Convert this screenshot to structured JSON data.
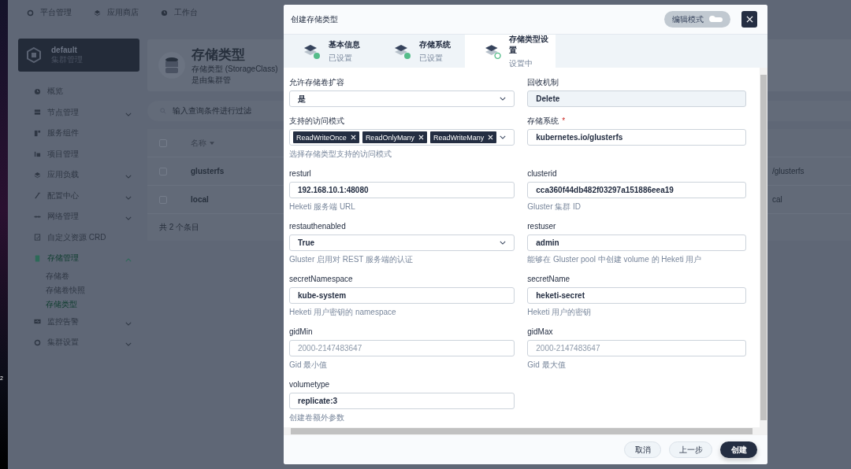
{
  "desktop": {
    "label": "2"
  },
  "top_nav": [
    {
      "label": "平台管理"
    },
    {
      "label": "应用商店"
    },
    {
      "label": "工作台"
    }
  ],
  "cluster_card": {
    "name": "default",
    "subtitle": "集群管理"
  },
  "sidebar": {
    "items": [
      {
        "label": "概览",
        "kind": "link",
        "selected": false
      },
      {
        "label": "节点管理",
        "kind": "group",
        "expanded": false,
        "selected": false
      },
      {
        "label": "服务组件",
        "kind": "link",
        "selected": false
      },
      {
        "label": "项目管理",
        "kind": "link",
        "selected": false
      },
      {
        "label": "应用负载",
        "kind": "group",
        "expanded": false,
        "selected": false
      },
      {
        "label": "配置中心",
        "kind": "group",
        "expanded": false,
        "selected": false
      },
      {
        "label": "网络管理",
        "kind": "group",
        "expanded": false,
        "selected": false
      },
      {
        "label": "自定义资源 CRD",
        "kind": "link",
        "selected": false
      },
      {
        "label": "存储管理",
        "kind": "group",
        "expanded": true,
        "selected": true,
        "children": [
          {
            "label": "存储卷",
            "selected": false
          },
          {
            "label": "存储卷快照",
            "selected": false
          },
          {
            "label": "存储类型",
            "selected": true
          }
        ]
      },
      {
        "label": "监控告警",
        "kind": "group",
        "expanded": false,
        "selected": false
      },
      {
        "label": "集群设置",
        "kind": "group",
        "expanded": false,
        "selected": false
      }
    ]
  },
  "page_header": {
    "title": "存储类型",
    "description": "存储类型 (StorageClass) 是由集群管"
  },
  "search": {
    "placeholder": "输入查询条件进行过滤"
  },
  "table": {
    "columns": [
      {
        "label": "名称"
      }
    ],
    "select_all": {
      "checked": false
    },
    "rows": [
      {
        "name": "glusterfs",
        "column_3": "/glusterfs",
        "checked": false
      },
      {
        "name": "local",
        "column_3": "cal",
        "checked": false
      }
    ],
    "footer": "共 2 个条目"
  },
  "dialog": {
    "title": "创建存储类型",
    "edit_mode": {
      "label": "编辑模式",
      "on": false
    },
    "steps": [
      {
        "title": "基本信息",
        "status_text": "已设置",
        "done": true,
        "selected": false
      },
      {
        "title": "存储系统",
        "status_text": "已设置",
        "done": true,
        "selected": false
      },
      {
        "title": "存储类型设置",
        "status_text": "设置中",
        "done": false,
        "selected": true
      }
    ],
    "fields": [
      {
        "label": "允许存储卷扩容",
        "kind": "select",
        "value": "是"
      },
      {
        "label": "回收机制",
        "kind": "readonly",
        "value": "Delete"
      },
      {
        "label": "支持的访问模式",
        "kind": "tags",
        "tags": [
          "ReadWriteOnce",
          "ReadOnlyMany",
          "ReadWriteMany"
        ],
        "hint": "选择存储类型支持的访问模式"
      },
      {
        "label": "存储系统",
        "kind": "input",
        "required_mark": "*",
        "value": "kubernetes.io/glusterfs"
      },
      {
        "label": "resturl",
        "kind": "input",
        "value": "192.168.10.1:48080",
        "hint": "Heketi 服务端 URL"
      },
      {
        "label": "clusterid",
        "kind": "input",
        "value": "cca360f44db482f03297a151886eea19",
        "hint": "Gluster 集群 ID"
      },
      {
        "label": "restauthenabled",
        "kind": "select",
        "value": "True",
        "hint": "Gluster 启用对 REST 服务端的认证"
      },
      {
        "label": "restuser",
        "kind": "input",
        "value": "admin",
        "hint": "能够在 Gluster pool 中创建 volume 的 Heketi 用户"
      },
      {
        "label": "secretNamespace",
        "kind": "input",
        "value": "kube-system",
        "hint": "Heketi 用户密钥的 namespace"
      },
      {
        "label": "secretName",
        "kind": "input",
        "value": "heketi-secret",
        "hint": "Heketi 用户的密钥"
      },
      {
        "label": "gidMin",
        "kind": "input",
        "placeholder": "2000-2147483647",
        "hint": "Gid 最小值"
      },
      {
        "label": "gidMax",
        "kind": "input",
        "placeholder": "2000-2147483647",
        "hint": "Gid 最大值"
      },
      {
        "label": "volumetype",
        "kind": "input",
        "value": "replicate:3",
        "hint": "创建卷额外参数"
      }
    ],
    "buttons": [
      {
        "label": "取消",
        "kind": "secondary"
      },
      {
        "label": "上一步",
        "kind": "secondary"
      },
      {
        "label": "创建",
        "kind": "primary"
      }
    ]
  }
}
